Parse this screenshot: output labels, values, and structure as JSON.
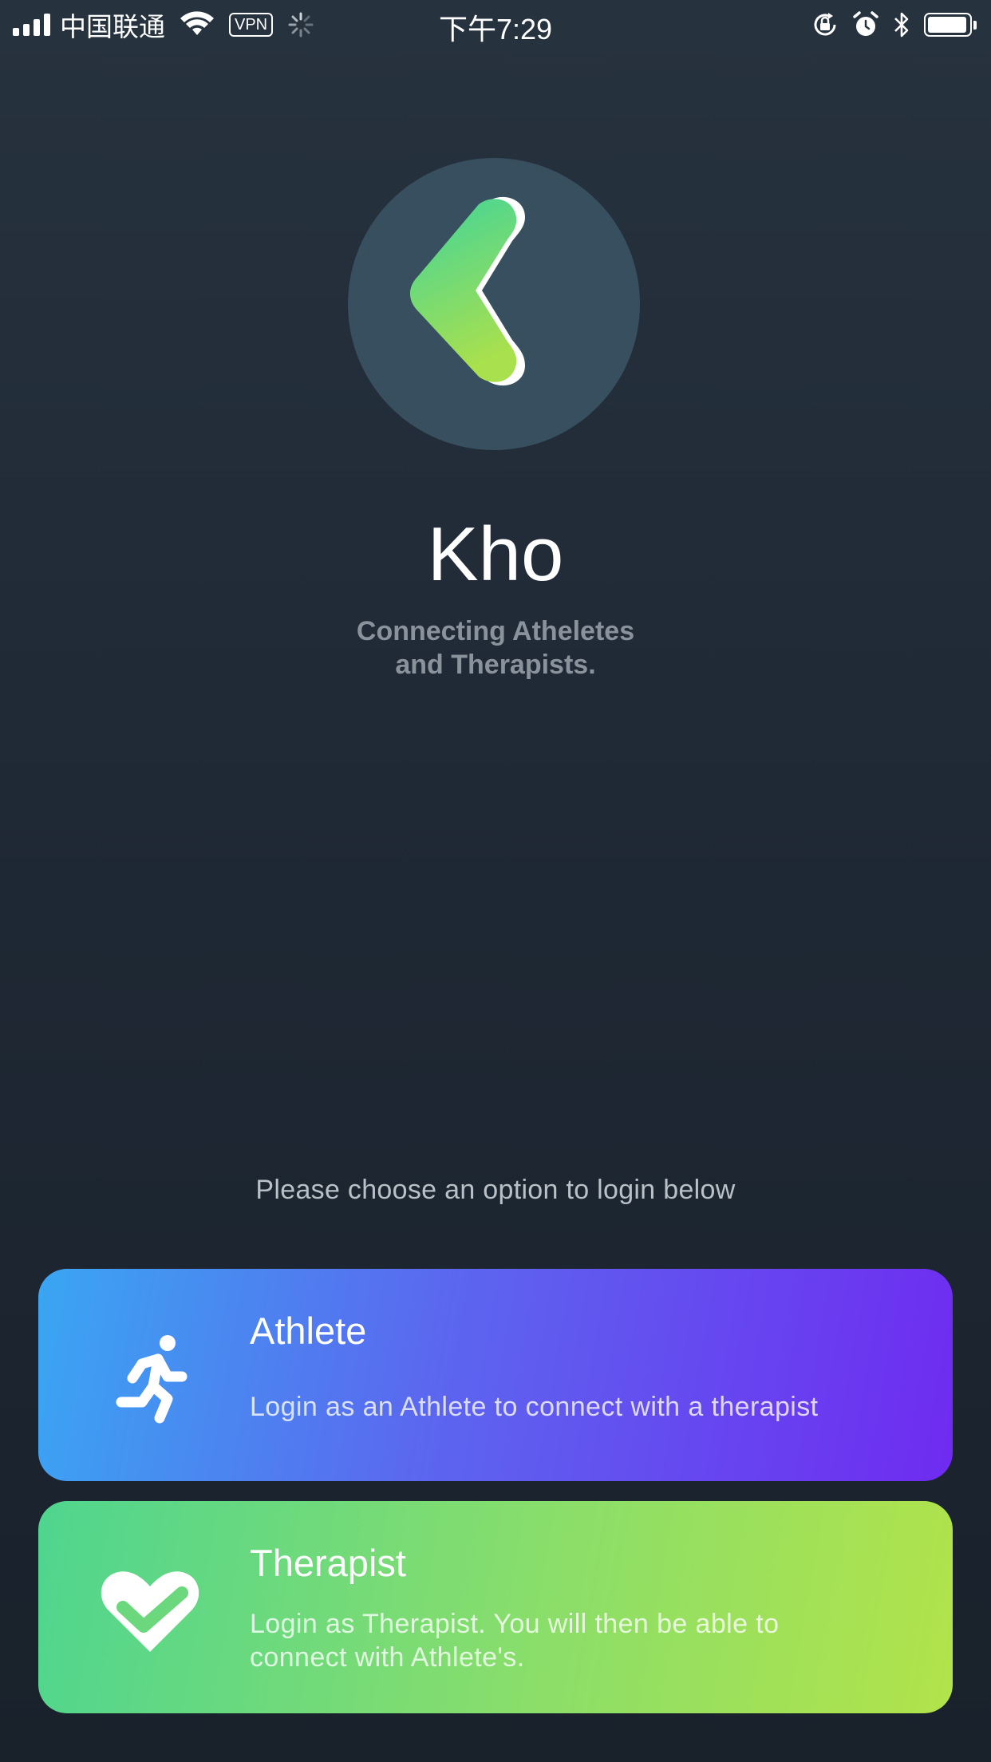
{
  "status_bar": {
    "carrier": "中国联通",
    "vpn": "VPN",
    "time": "下午7:29",
    "battery_level": 0.95,
    "icons": [
      "signal-icon",
      "wifi-icon",
      "activity-spinner-icon",
      "rotation-lock-icon",
      "alarm-icon",
      "bluetooth-icon",
      "battery-icon"
    ]
  },
  "app": {
    "logo_icon": "kho-chevron-logo-icon",
    "name": "Kho",
    "tagline_line1": "Connecting Atheletes",
    "tagline_line2": "and Therapists."
  },
  "login": {
    "prompt": "Please choose an option to login below",
    "options": [
      {
        "icon": "running-person-icon",
        "title": "Athlete",
        "description": "Login as an Athlete to connect with a therapist",
        "gradient": [
          "#3aa6f2",
          "#6f2bf0"
        ]
      },
      {
        "icon": "heart-check-icon",
        "title": "Therapist",
        "description_line1": "Login as Therapist. You will then be able to",
        "description_line2": "connect with Athlete's.",
        "gradient": [
          "#4fd58f",
          "#b2e34a"
        ]
      }
    ]
  },
  "colors": {
    "background": "#212b36",
    "logo_circle": "#384f60",
    "tagline": "#8a939c"
  }
}
